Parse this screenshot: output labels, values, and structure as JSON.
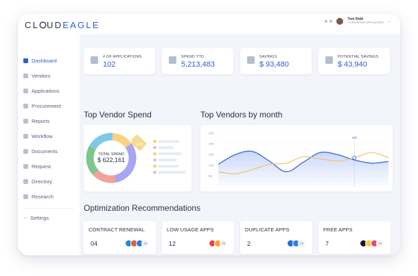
{
  "app": {
    "logo_prefix": "CL",
    "logo_middle": "UD",
    "logo_suffix": "EAGLE",
    "user_name": "Tom Ridd",
    "user_role": "IT ENTERPRISE APPLICATIONS"
  },
  "sidebar": {
    "items": [
      {
        "label": "Dashboard",
        "icon": "home-icon",
        "active": true
      },
      {
        "label": "Vendors",
        "icon": "store-icon"
      },
      {
        "label": "Applications",
        "icon": "grid-icon"
      },
      {
        "label": "Procurement",
        "icon": "cart-icon"
      },
      {
        "label": "Reports",
        "icon": "document-icon"
      },
      {
        "label": "Workflow",
        "icon": "workflow-icon"
      },
      {
        "label": "Documents",
        "icon": "folder-icon"
      },
      {
        "label": "Request",
        "icon": "request-icon"
      },
      {
        "label": "Directory",
        "icon": "directory-icon"
      },
      {
        "label": "Research",
        "icon": "research-icon"
      }
    ],
    "settings_label": "Settings"
  },
  "kpis": [
    {
      "label": "# OF APPLICATIONS",
      "value": "102",
      "icon": "apps-icon"
    },
    {
      "label": "SPEND YTD",
      "value": "5,213,483",
      "icon": "spend-icon"
    },
    {
      "label": "SAVINGS",
      "value": "$ 93,480",
      "icon": "savings-icon"
    },
    {
      "label": "POTENTIAL SAVINGS",
      "value": "$ 43,940",
      "icon": "potential-savings-icon"
    }
  ],
  "sections": {
    "vendor_spend": "Top Vendor Spend",
    "vendors_month": "Top Vendors by month",
    "optimization": "Optimization Recommendations"
  },
  "donut": {
    "center_label": "TOTAL SPEND",
    "center_value": "$ 622,161",
    "callout": "14%",
    "colors": [
      "#a8a4f0",
      "#f1a29a",
      "#7fc58d",
      "#7fc9e7",
      "#f6d37e"
    ]
  },
  "chart_data": {
    "type": "line",
    "title": "Top Vendors by month",
    "x": [
      0,
      1,
      2,
      3,
      4,
      5,
      6,
      7,
      8,
      9,
      10
    ],
    "yticks": [
      "250",
      "200",
      "150",
      "100",
      "50"
    ],
    "series": [
      {
        "values": [
          105,
          150,
          165,
          120,
          70,
          115,
          160,
          150,
          125,
          110,
          118
        ]
      },
      {
        "values": [
          70,
          60,
          80,
          105,
          110,
          140,
          130,
          120,
          135,
          160,
          135
        ]
      }
    ],
    "point_label": "180",
    "ylim": [
      0,
      250
    ]
  },
  "optimization": [
    {
      "title": "CONTRACT RENEWAL",
      "count": "04",
      "apps": [
        "#1b8bd6",
        "#e45a2b",
        "#2c7be5"
      ],
      "more": "+3"
    },
    {
      "title": "LOW USAGE APPS",
      "count": "12",
      "apps": [
        "#e5473f",
        "#f6a23b"
      ],
      "more": "+3"
    },
    {
      "title": "DUPLICATE APPS",
      "count": "2",
      "apps": [
        "#1e6fd9",
        "#2b85e5"
      ],
      "more": "+3"
    },
    {
      "title": "FREE APPS",
      "count": "7",
      "apps": [
        "#1a1a1a",
        "#ffcb3d",
        "#e94b73"
      ],
      "more": "+3"
    }
  ]
}
